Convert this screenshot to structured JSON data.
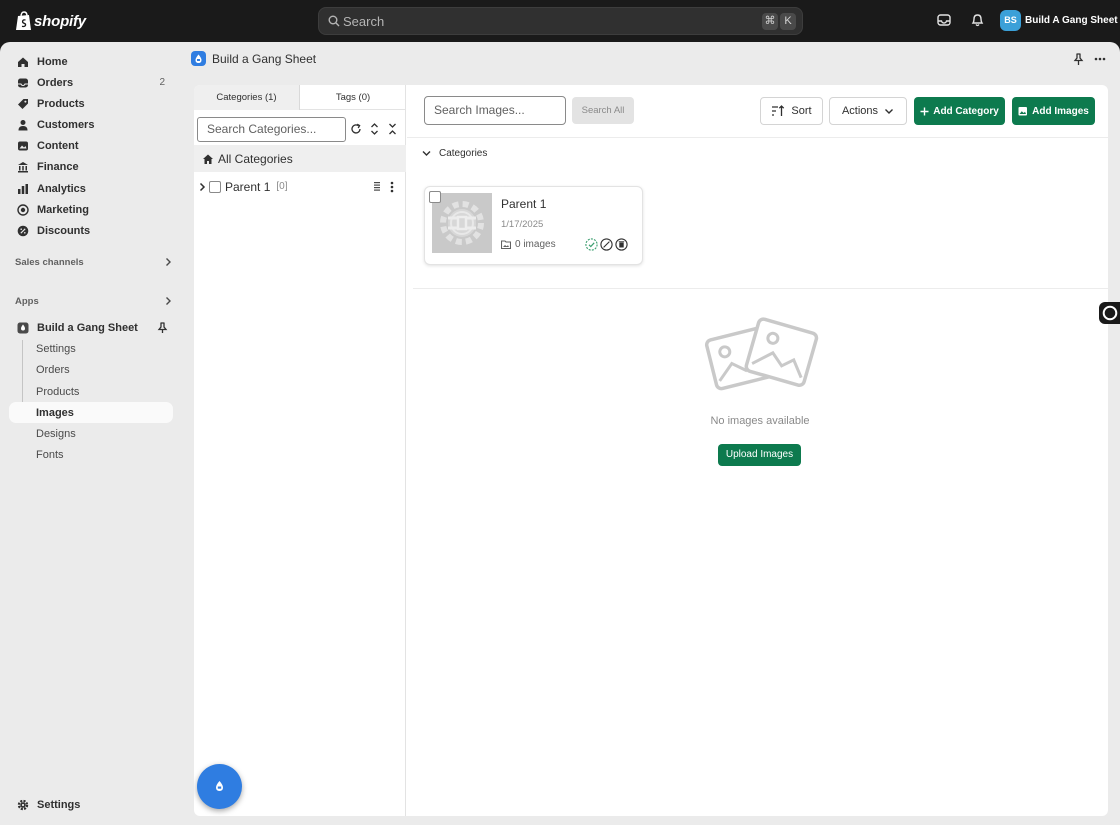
{
  "topbar": {
    "brand": "shopify",
    "search_placeholder": "Search",
    "shortcut_cmd": "⌘",
    "shortcut_key": "K",
    "store_initials": "BS",
    "store_name": "Build A Gang Sheet"
  },
  "sidebar": {
    "items": [
      {
        "label": "Home",
        "icon": "home-icon"
      },
      {
        "label": "Orders",
        "icon": "orders-icon",
        "badge": "2"
      },
      {
        "label": "Products",
        "icon": "tag-icon"
      },
      {
        "label": "Customers",
        "icon": "person-icon"
      },
      {
        "label": "Content",
        "icon": "content-icon"
      },
      {
        "label": "Finance",
        "icon": "bank-icon"
      },
      {
        "label": "Analytics",
        "icon": "chart-icon"
      },
      {
        "label": "Marketing",
        "icon": "target-icon"
      },
      {
        "label": "Discounts",
        "icon": "discount-icon"
      }
    ],
    "sales_channels_label": "Sales channels",
    "apps_label": "Apps",
    "app_name": "Build a Gang Sheet",
    "app_subitems": [
      "Settings",
      "Orders",
      "Products",
      "Images",
      "Designs",
      "Fonts"
    ],
    "active_subitem": "Images",
    "settings_label": "Settings"
  },
  "app_header": {
    "title": "Build a Gang Sheet"
  },
  "categories_panel": {
    "tabs": [
      "Categories (1)",
      "Tags (0)"
    ],
    "active_tab": "Categories (1)",
    "search_placeholder": "Search Categories...",
    "all_categories_label": "All Categories",
    "tree": [
      {
        "name": "Parent 1",
        "count": "[0]"
      }
    ]
  },
  "images_panel": {
    "search_placeholder": "Search Images...",
    "search_all_label": "Search All",
    "sort_label": "Sort",
    "actions_label": "Actions",
    "add_category_label": "Add Category",
    "add_images_label": "Add Images",
    "section_label": "Categories",
    "cards": [
      {
        "title": "Parent 1",
        "date": "1/17/2025",
        "image_count": "0 images"
      }
    ],
    "empty_text": "No images available",
    "upload_label": "Upload Images"
  },
  "colors": {
    "primary_green": "#0d7a4e",
    "app_blue": "#2f7de1",
    "topbar": "#1a1a1a",
    "frame_bg": "#ebebeb"
  }
}
